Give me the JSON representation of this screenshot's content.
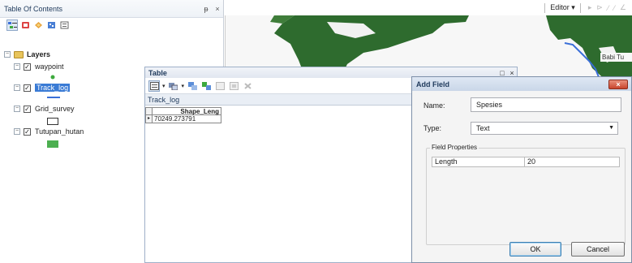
{
  "toc": {
    "title": "Table Of Contents",
    "pin_glyph": "ᵽ",
    "close_glyph": "×",
    "layers_group": "Layers",
    "layers": [
      {
        "name": "waypoint",
        "checked": "✓",
        "symbol_color": "#3daa3d"
      },
      {
        "name": "Track_log",
        "checked": "✓",
        "symbol_color": "#3a6fd8"
      },
      {
        "name": "Grid_survey",
        "checked": "✓",
        "symbol_color": "#ffffff"
      },
      {
        "name": "Tutupan_hutan",
        "checked": "✓",
        "symbol_color": "#4caf50"
      }
    ],
    "expander_glyph": "−"
  },
  "top_toolbar": {
    "editor_label": "Editor ▾"
  },
  "map": {
    "label": "Babi Tu",
    "land_color": "#2e6b2e",
    "water_color": "#f7f7f7",
    "line_color": "#3a6fd8"
  },
  "table": {
    "title": "Table",
    "restore_glyph": "□",
    "close_glyph": "×",
    "tab_name": "Track_log",
    "columns": [
      "Shape_Leng"
    ],
    "rows": [
      [
        "70249.273791"
      ]
    ],
    "row_marker": "▸"
  },
  "dialog": {
    "title": "Add Field",
    "close_glyph": "×",
    "name_label": "Name:",
    "name_value": "Spesies",
    "type_label": "Type:",
    "type_value": "Text",
    "dropdown_glyph": "▼",
    "field_properties_label": "Field Properties",
    "properties": [
      {
        "name": "Length",
        "value": "20"
      }
    ],
    "ok_label": "OK",
    "cancel_label": "Cancel"
  }
}
